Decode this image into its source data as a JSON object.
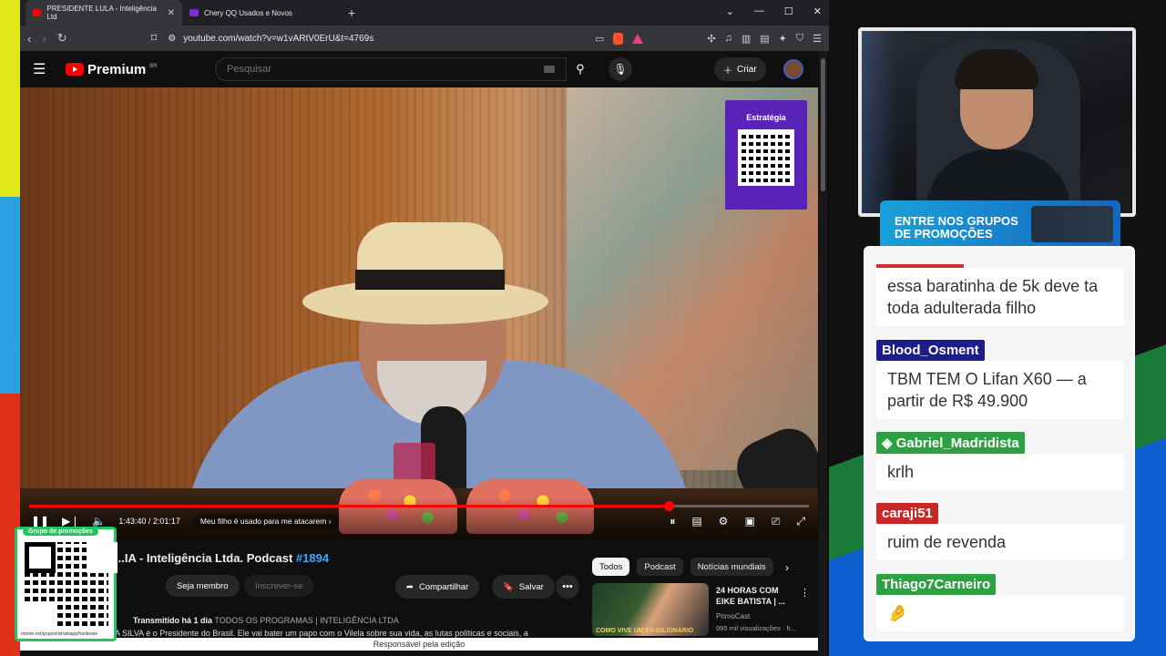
{
  "browser": {
    "tabs": [
      {
        "label": "PRESIDENTE LULA - Inteligência Ltd",
        "active": true,
        "favicon_color": "#ff0000"
      },
      {
        "label": "Chery QQ Usados e Novos",
        "active": false,
        "favicon_color": "#7b2fd6"
      }
    ],
    "url": "youtube.com/watch?v=w1vARtV0ErU&t=4769s"
  },
  "youtube": {
    "logo_text": "Premium",
    "logo_region": "BR",
    "search_placeholder": "Pesquisar",
    "create_label": "Criar"
  },
  "video": {
    "ad_brand": "Estratégia",
    "progress": 0.82,
    "time": "1:43:40 / 2:01:17",
    "chapter": "Meu filho é usado para me atacarem"
  },
  "below": {
    "title_prefix": "...IA - Inteligência Ltda. Podcast",
    "title_tag": "#1894",
    "member_label": "Seja membro",
    "subscribe_label": "Inscrever-se",
    "share_label": "Compartilhar",
    "save_label": "Salvar",
    "meta_time": "Transmitido há 1 dia",
    "meta_tags": "TODOS OS PROGRAMAS | INTELIGÊNCIA LTDA",
    "description": "A SILVA é o Presidente do Brasil. Ele vai bater um papo com o Vilela sobre sua vida, as lutas políticas e sociais, a",
    "chips": [
      "Todos",
      "Podcast",
      "Notícias mundiais"
    ],
    "rec": {
      "title": "24 HORAS COM EIKE BATISTA | ...",
      "channel": "PrimoCast",
      "views": "995 mil visualizações · h...",
      "thumb_text": "COMO VIVE UM EX-BILIONÁRIO"
    },
    "status_text": "Responsável pela edição"
  },
  "overlay": {
    "qr_label": "Grupo de promoções",
    "qr_url": "rtstore.net/grupos/whatsapp/hardware"
  },
  "promo": {
    "line1": "ENTRE NOS GRUPOS",
    "line2": "DE PROMOÇÕES"
  },
  "chat": [
    {
      "name": "",
      "name_color": "#d32f2f",
      "text": "essa baratinha de 5k deve ta toda adulterada filho"
    },
    {
      "name": "Blood_Osment",
      "name_color": "#1e1b8a",
      "text": "TBM TEM O Lifan X60 — a partir de R$ 49.900"
    },
    {
      "name": "Gabriel_Madridista",
      "name_color": "#2ea043",
      "text": "krlh"
    },
    {
      "name": "caraji51",
      "name_color": "#c62828",
      "text": "ruim de revenda"
    },
    {
      "name": "Thiago7Carneiro",
      "name_color": "#2ea043",
      "text": "🤌"
    }
  ]
}
